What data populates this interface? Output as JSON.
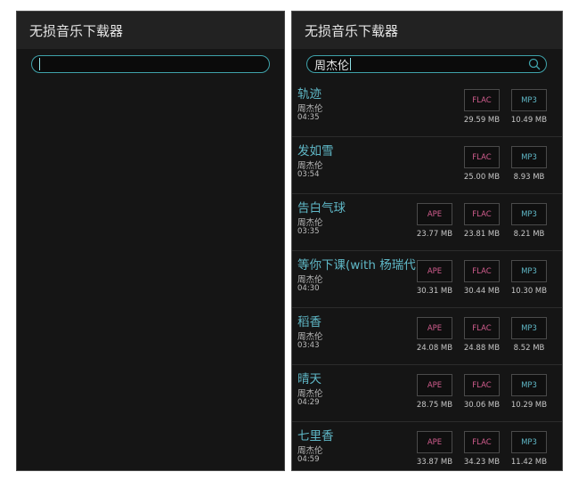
{
  "app_title": "无损音乐下载器",
  "left": {
    "search_value": ""
  },
  "right": {
    "search_value": "周杰伦",
    "songs": [
      {
        "title": "轨迹",
        "artist": "周杰伦",
        "duration": "04:35",
        "ape": null,
        "flac": "FLAC",
        "mp3": "MP3",
        "flac_size": "29.59 MB",
        "mp3_size": "10.49 MB"
      },
      {
        "title": "发如雪",
        "artist": "周杰伦",
        "duration": "03:54",
        "ape": null,
        "flac": "FLAC",
        "mp3": "MP3",
        "flac_size": "25.00 MB",
        "mp3_size": "8.93 MB"
      },
      {
        "title": "告白气球",
        "artist": "周杰伦",
        "duration": "03:35",
        "ape": "APE",
        "flac": "FLAC",
        "mp3": "MP3",
        "ape_size": "23.77 MB",
        "flac_size": "23.81 MB",
        "mp3_size": "8.21 MB"
      },
      {
        "title": "等你下课(with 杨瑞代)",
        "artist": "周杰伦",
        "duration": "04:30",
        "ape": "APE",
        "flac": "FLAC",
        "mp3": "MP3",
        "ape_size": "30.31 MB",
        "flac_size": "30.44 MB",
        "mp3_size": "10.30 MB"
      },
      {
        "title": "稻香",
        "artist": "周杰伦",
        "duration": "03:43",
        "ape": "APE",
        "flac": "FLAC",
        "mp3": "MP3",
        "ape_size": "24.08 MB",
        "flac_size": "24.88 MB",
        "mp3_size": "8.52 MB"
      },
      {
        "title": "晴天",
        "artist": "周杰伦",
        "duration": "04:29",
        "ape": "APE",
        "flac": "FLAC",
        "mp3": "MP3",
        "ape_size": "28.75 MB",
        "flac_size": "30.06 MB",
        "mp3_size": "10.29 MB"
      },
      {
        "title": "七里香",
        "artist": "周杰伦",
        "duration": "04:59",
        "ape": "APE",
        "flac": "FLAC",
        "mp3": "MP3",
        "ape_size": "33.87 MB",
        "flac_size": "34.23 MB",
        "mp3_size": "11.42 MB"
      }
    ]
  },
  "colors": {
    "accent": "#5fb7c6",
    "lossless_label": "#d25d8e",
    "background": "#151515",
    "appbar": "#222222"
  },
  "icons": {
    "search": "search-icon"
  }
}
